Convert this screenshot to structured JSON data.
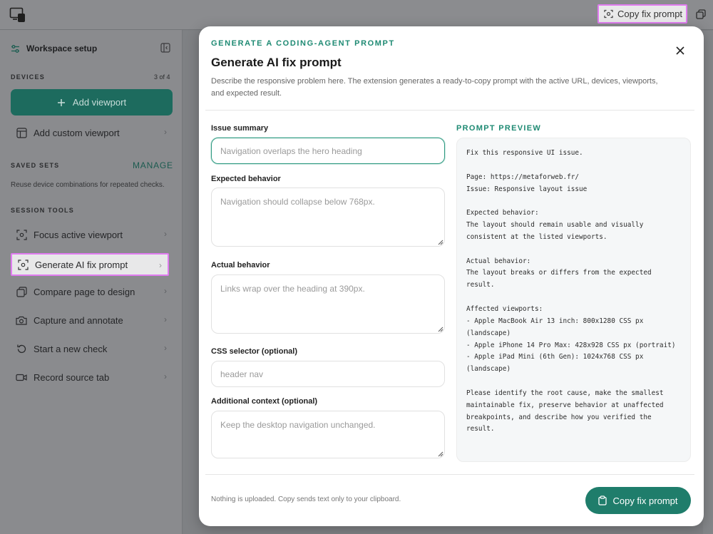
{
  "topbar": {
    "copy_label": "Copy fix prompt"
  },
  "sidebar": {
    "title": "Workspace setup",
    "devices_label": "DEVICES",
    "devices_count": "3 of 4",
    "add_viewport": "Add viewport",
    "add_custom_viewport": "Add custom viewport",
    "saved_sets_label": "SAVED SETS",
    "manage": "MANAGE",
    "saved_sets_desc": "Reuse device combinations for repeated checks.",
    "session_tools_label": "SESSION TOOLS",
    "tools": [
      {
        "label": "Focus active viewport"
      },
      {
        "label": "Generate AI fix prompt"
      },
      {
        "label": "Compare page to design"
      },
      {
        "label": "Capture and annotate"
      },
      {
        "label": "Start a new check"
      },
      {
        "label": "Record source tab"
      }
    ]
  },
  "modal": {
    "eyebrow": "GENERATE A CODING-AGENT PROMPT",
    "title": "Generate AI fix prompt",
    "description": "Describe the responsive problem here. The extension generates a ready-to-copy prompt with the active URL, devices, viewports, and expected result.",
    "fields": {
      "issue_summary": {
        "label": "Issue summary",
        "placeholder": "Navigation overlaps the hero heading"
      },
      "expected": {
        "label": "Expected behavior",
        "placeholder": "Navigation should collapse below 768px."
      },
      "actual": {
        "label": "Actual behavior",
        "placeholder": "Links wrap over the heading at 390px."
      },
      "selector": {
        "label": "CSS selector (optional)",
        "placeholder": "header nav"
      },
      "context": {
        "label": "Additional context (optional)",
        "placeholder": "Keep the desktop navigation unchanged."
      }
    },
    "preview_label": "PROMPT PREVIEW",
    "preview_text": "Fix this responsive UI issue.\n\nPage: https://metaforweb.fr/\nIssue: Responsive layout issue\n\nExpected behavior:\nThe layout should remain usable and visually consistent at the listed viewports.\n\nActual behavior:\nThe layout breaks or differs from the expected result.\n\nAffected viewports:\n- Apple MacBook Air 13 inch: 800x1280 CSS px (landscape)\n- Apple iPhone 14 Pro Max: 428x928 CSS px (portrait)\n- Apple iPad Mini (6th Gen): 1024x768 CSS px (landscape)\n\nPlease identify the root cause, make the smallest maintainable fix, preserve behavior at unaffected breakpoints, and describe how you verified the result.",
    "footer_note": "Nothing is uploaded. Copy sends text only to your clipboard.",
    "copy_button": "Copy fix prompt"
  },
  "colors": {
    "accent": "#1f7d6b",
    "highlight": "#e07cf0",
    "eyebrow": "#1e8a73"
  },
  "icons": [
    "app-logo-icon",
    "scan-icon",
    "layers-icon",
    "sliders-icon",
    "sidebar-collapse-icon",
    "plus-icon",
    "layout-icon",
    "focus-icon",
    "compare-icon",
    "camera-icon",
    "refresh-icon",
    "video-icon",
    "chevron-right-icon",
    "close-icon",
    "clipboard-icon",
    "resize-grip-icon"
  ]
}
